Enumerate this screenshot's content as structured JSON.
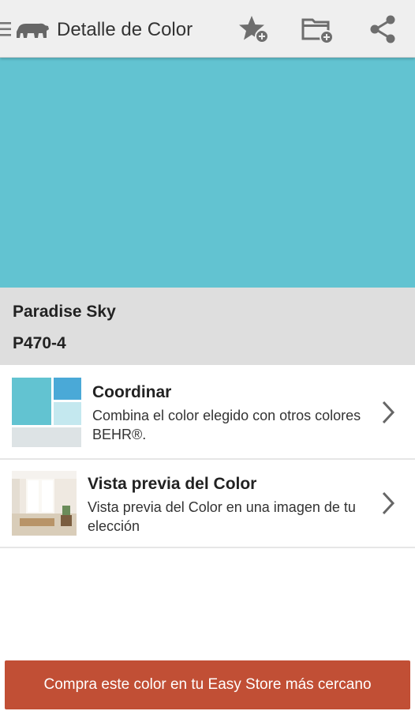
{
  "appbar": {
    "title": "Detalle de Color",
    "icons": [
      "menu-icon",
      "bear-logo-icon",
      "add-favorite-star-icon",
      "add-to-folder-icon",
      "share-icon"
    ]
  },
  "color": {
    "name": "Paradise Sky",
    "code": "P470-4",
    "swatch_hex": "#62c3d1"
  },
  "options": [
    {
      "title": "Coordinar",
      "description": "Combina el color elegido con otros colores BEHR®."
    },
    {
      "title": "Vista previa del Color",
      "description": "Vista previa del Color en una imagen de tu elección"
    }
  ],
  "footer": {
    "cta_label": "Compra este color en tu Easy Store más cercano",
    "cta_color": "#c14f35"
  }
}
